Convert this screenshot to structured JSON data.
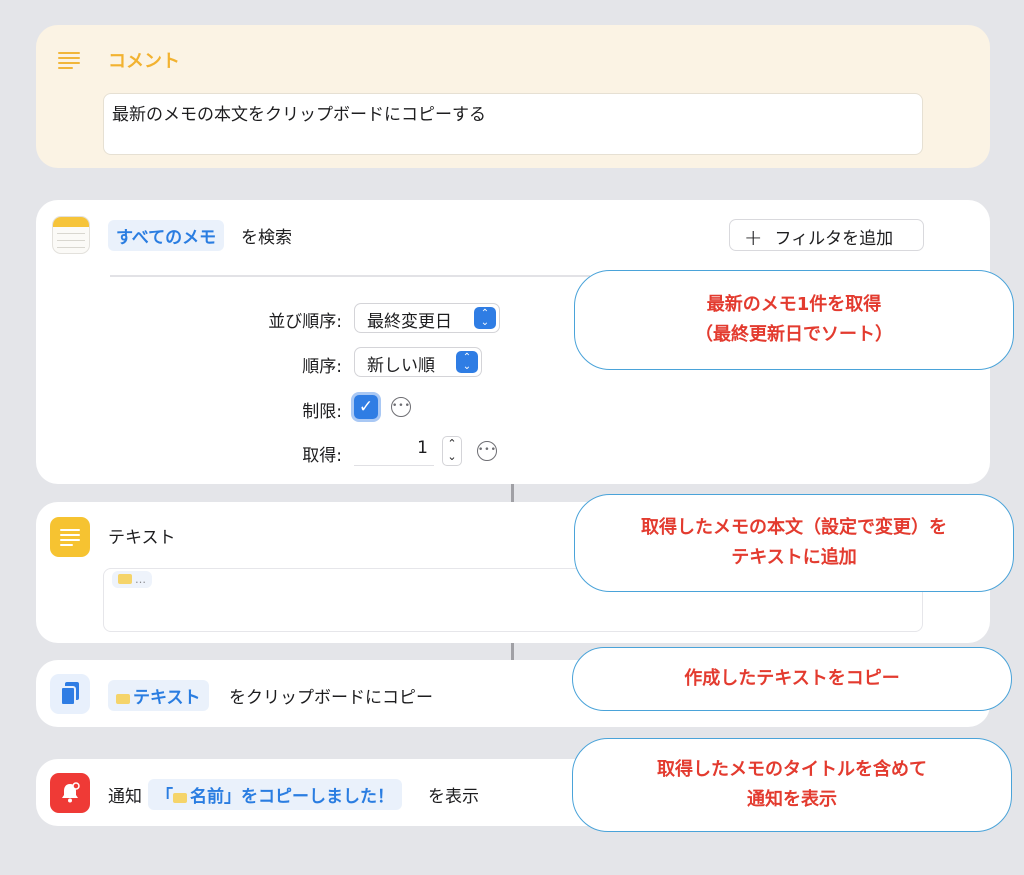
{
  "comment": {
    "title": "コメント",
    "text": "最新のメモの本文をクリップボードにコピーする"
  },
  "find_notes": {
    "token": "すべてのメモ",
    "suffix": "を検索",
    "add_filter_label": "フィルタを追加",
    "sort_label": "並び順序:",
    "sort_value": "最終変更日",
    "order_label": "順序:",
    "order_value": "新しい順",
    "limit_label": "制限:",
    "limit_checked": true,
    "get_label": "取得:",
    "get_value": "1"
  },
  "text_action": {
    "title": "テキスト",
    "chip_text": "…"
  },
  "copy_action": {
    "token": "テキスト",
    "suffix": "をクリップボードにコピー"
  },
  "notify_action": {
    "prefix": "通知",
    "open_quote": "「",
    "token_name": "名前",
    "token_rest": "」をコピーしました！",
    "suffix": "を表示"
  },
  "callouts": {
    "c1_line1": "最新のメモ1件を取得",
    "c1_line2": "（最終更新日でソート）",
    "c2_line1": "取得したメモの本文（設定で変更）を",
    "c2_line2": "テキストに追加",
    "c3_line1": "作成したテキストをコピー",
    "c4_line1": "取得したメモのタイトルを含めて",
    "c4_line2": "通知を表示"
  },
  "colors": {
    "background": "#e4e5e9",
    "comment_bg": "#fbf3e4",
    "accent_blue": "#2f7de4",
    "callout_text": "#e33b2f",
    "callout_border": "#4aa3d9"
  }
}
